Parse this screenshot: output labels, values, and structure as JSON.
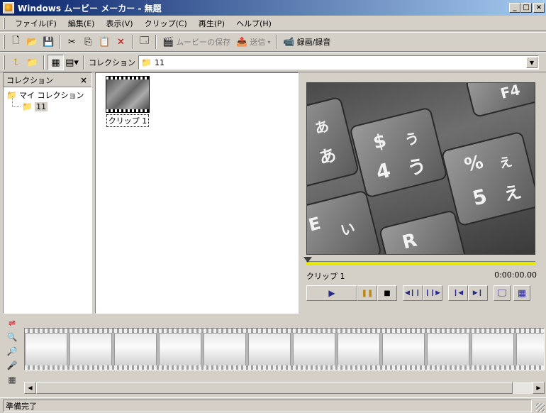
{
  "window": {
    "title": "Windows ムービー メーカー - 無題",
    "minimize": "_",
    "maximize": "□",
    "close": "×"
  },
  "menu": [
    "ファイル(F)",
    "編集(E)",
    "表示(V)",
    "クリップ(C)",
    "再生(P)",
    "ヘルプ(H)"
  ],
  "toolbar": {
    "save_movie": "ムービーの保存",
    "send": "送信",
    "record": "録画/録音"
  },
  "collection_bar": {
    "label": "コレクション",
    "selected": "11"
  },
  "collections_pane": {
    "header": "コレクション",
    "close": "×",
    "root": "マイ コレクション",
    "child": "11"
  },
  "contents": {
    "clips": [
      {
        "label": "クリップ 1"
      }
    ]
  },
  "preview": {
    "clip_name": "クリップ 1",
    "time": "0:00:00.00",
    "keys": [
      {
        "main": "$",
        "kana": "う",
        "num": "4",
        "kana2": "う"
      },
      {
        "main": "%",
        "kana": "え",
        "num": "5",
        "kana2": "え"
      },
      {
        "main": "F4"
      },
      {
        "main": "E",
        "kana": "い"
      },
      {
        "main": "R"
      },
      {
        "main": "あ",
        "kana": "あ"
      }
    ]
  },
  "storyboard": {
    "frame_count": 12
  },
  "status": {
    "text": "準備完了"
  },
  "colors": {
    "title_start": "#0a246a",
    "title_end": "#a6caf0",
    "face": "#d4d0c8",
    "seek_track": "#e6e600"
  }
}
